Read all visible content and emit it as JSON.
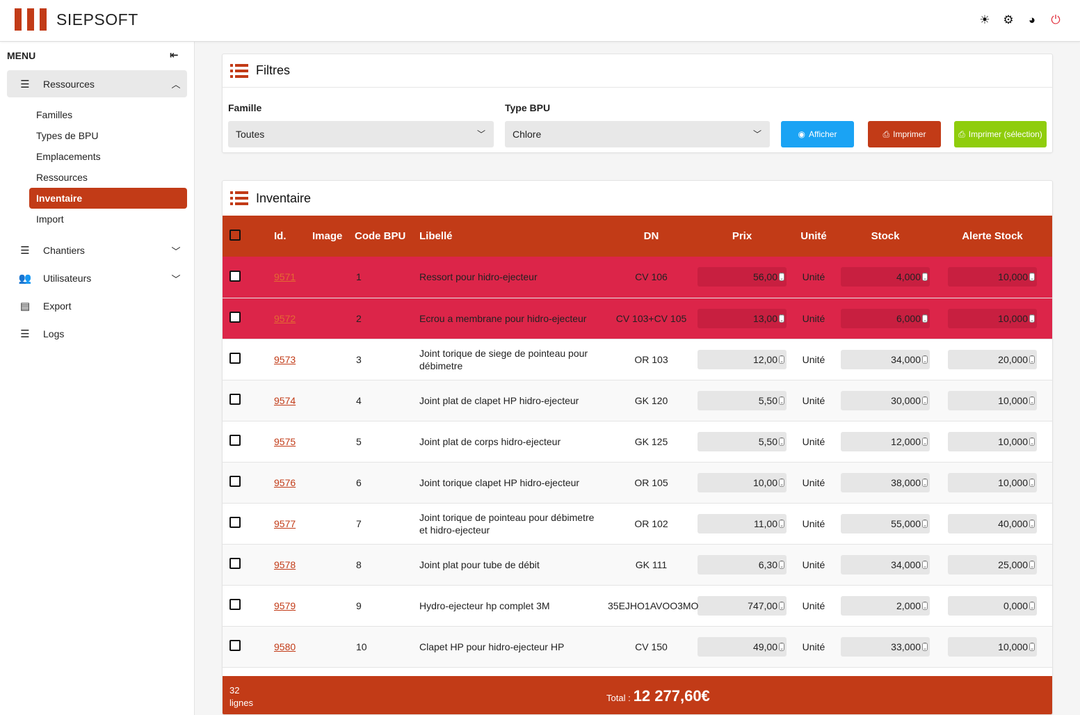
{
  "app": {
    "name": "SIEPSOFT"
  },
  "header": {
    "icons": [
      "sun-icon",
      "gear-icon",
      "globe-icon",
      "power-icon"
    ]
  },
  "sidebar": {
    "menu_title": "MENU",
    "ressources_label": "Ressources",
    "subitems": [
      "Familles",
      "Types de BPU",
      "Emplacements",
      "Ressources",
      "Inventaire",
      "Import"
    ],
    "active_subitem": "Inventaire",
    "items": [
      {
        "label": "Chantiers",
        "icon": "list-icon",
        "expandable": true
      },
      {
        "label": "Utilisateurs",
        "icon": "users-icon",
        "expandable": true
      },
      {
        "label": "Export",
        "icon": "file-export-icon",
        "expandable": false
      },
      {
        "label": "Logs",
        "icon": "list-icon",
        "expandable": false
      }
    ]
  },
  "filters": {
    "title": "Filtres",
    "famille_label": "Famille",
    "famille_value": "Toutes",
    "type_label": "Type BPU",
    "type_value": "Chlore",
    "btn_afficher": "Afficher",
    "btn_imprimer": "Imprimer",
    "btn_imprimer_sel": "Imprimer (sélection)"
  },
  "inventory": {
    "title": "Inventaire",
    "columns": [
      "Id.",
      "Image",
      "Code BPU",
      "Libellé",
      "DN",
      "Prix",
      "Unité",
      "Stock",
      "Alerte Stock"
    ],
    "rows": [
      {
        "id": "9571",
        "code": "1",
        "libelle": "Ressort pour hidro-ejecteur",
        "dn": "CV 106",
        "prix": "56,00",
        "unite": "Unité",
        "stock": "4,000",
        "alerte": "10,000",
        "alert": true
      },
      {
        "id": "9572",
        "code": "2",
        "libelle": "Ecrou a membrane pour hidro-ejecteur",
        "dn": "CV 103+CV 105",
        "prix": "13,00",
        "unite": "Unité",
        "stock": "6,000",
        "alerte": "10,000",
        "alert": true
      },
      {
        "id": "9573",
        "code": "3",
        "libelle": "Joint torique de siege de pointeau pour débimetre",
        "dn": "OR 103",
        "prix": "12,00",
        "unite": "Unité",
        "stock": "34,000",
        "alerte": "20,000",
        "alert": false
      },
      {
        "id": "9574",
        "code": "4",
        "libelle": "Joint plat de clapet HP hidro-ejecteur",
        "dn": "GK 120",
        "prix": "5,50",
        "unite": "Unité",
        "stock": "30,000",
        "alerte": "10,000",
        "alert": false
      },
      {
        "id": "9575",
        "code": "5",
        "libelle": "Joint plat de corps hidro-ejecteur",
        "dn": "GK 125",
        "prix": "5,50",
        "unite": "Unité",
        "stock": "12,000",
        "alerte": "10,000",
        "alert": false
      },
      {
        "id": "9576",
        "code": "6",
        "libelle": "Joint torique clapet HP hidro-ejecteur",
        "dn": "OR 105",
        "prix": "10,00",
        "unite": "Unité",
        "stock": "38,000",
        "alerte": "10,000",
        "alert": false
      },
      {
        "id": "9577",
        "code": "7",
        "libelle": "Joint torique de pointeau pour débimetre et hidro-ejecteur",
        "dn": "OR 102",
        "prix": "11,00",
        "unite": "Unité",
        "stock": "55,000",
        "alerte": "40,000",
        "alert": false
      },
      {
        "id": "9578",
        "code": "8",
        "libelle": "Joint plat pour tube de débit",
        "dn": "GK 111",
        "prix": "6,30",
        "unite": "Unité",
        "stock": "34,000",
        "alerte": "25,000",
        "alert": false
      },
      {
        "id": "9579",
        "code": "9",
        "libelle": "Hydro-ejecteur hp complet 3M",
        "dn": "35EJHO1AVOO3MO",
        "prix": "747,00",
        "unite": "Unité",
        "stock": "2,000",
        "alerte": "0,000",
        "alert": false
      },
      {
        "id": "9580",
        "code": "10",
        "libelle": "Clapet HP pour hidro-ejecteur HP",
        "dn": "CV 150",
        "prix": "49,00",
        "unite": "Unité",
        "stock": "33,000",
        "alerte": "10,000",
        "alert": false
      }
    ],
    "footer": {
      "count": "32",
      "count_label": "lignes",
      "total_label": "Total :",
      "total_value": "12 277,60€"
    }
  },
  "colors": {
    "brand": "#c23b17",
    "alert_row": "#dc2549",
    "btn_blue": "#1aa3f4",
    "btn_green": "#8fcd0c",
    "power": "#e23340"
  }
}
